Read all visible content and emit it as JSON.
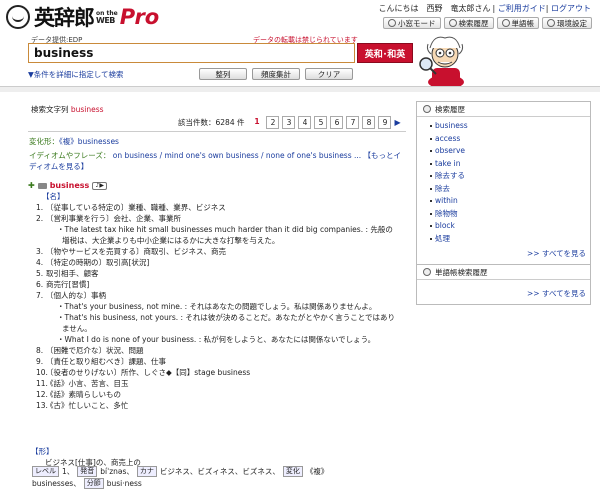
{
  "header": {
    "logo_text": "英辞郎",
    "logo_sub_top": "on the",
    "logo_sub_bottom": "WEB",
    "logo_pro": "Pro",
    "greeting": "こんにちは　西野　竜太郎さん",
    "nav": [
      {
        "label": "ご利用ガイド"
      },
      {
        "label": "ログアウト"
      }
    ],
    "toolbar": [
      {
        "label": "小窓モード",
        "icon": "window-icon"
      },
      {
        "label": "検索履歴",
        "icon": "history-icon"
      },
      {
        "label": "単語帳",
        "icon": "wordbook-icon"
      },
      {
        "label": "環境設定",
        "icon": "gear-icon"
      }
    ]
  },
  "search": {
    "provider": "データ提供:EDP",
    "notice": "データの転載は禁じられています",
    "query": "business",
    "dict_select": "英和･和英",
    "detail_link": "▼条件を詳細に指定して検索",
    "buttons": [
      "整列",
      "頻度集計",
      "クリア"
    ]
  },
  "results": {
    "query_label": "検索文字列",
    "query_value": "business",
    "count_label": "該当件数：6284 件",
    "pages": [
      "1",
      "2",
      "3",
      "4",
      "5",
      "6",
      "7",
      "8",
      "9"
    ],
    "current_page": "1",
    "inflect_label": "変化形：",
    "inflect_value": "《複》businesses",
    "idiom_label": "イディオムやフレーズ：",
    "idioms": "on business / mind one's own business / none of one's business ...",
    "idiom_more": "【もっとイディオムを見る】"
  },
  "entry": {
    "headword": "business",
    "audio_label": "♪▶",
    "pos_noun": "【名】",
    "lines": [
      {
        "type": "sense",
        "num": "1.",
        "text": "〔従事している特定の〕業種、職種、業界、ビジネス"
      },
      {
        "type": "sense",
        "num": "2.",
        "text": "〔営利事業を行う〕会社、企業、事業所"
      },
      {
        "type": "ex",
        "text": "・The latest tax hike hit small businesses much harder than it did big companies. : 先般の"
      },
      {
        "type": "excont",
        "text": "増税は、大企業よりも中小企業にはるかに大きな打撃を与えた。"
      },
      {
        "type": "sense",
        "num": "3.",
        "text": "〔物やサービスを売買する〕商取引、ビジネス、商売"
      },
      {
        "type": "sense",
        "num": "4.",
        "text": "〔特定の時期の〕取引高[状況]"
      },
      {
        "type": "sense",
        "num": "5.",
        "text": "取引相手、顧客"
      },
      {
        "type": "sense",
        "num": "6.",
        "text": "商売行[習慣]"
      },
      {
        "type": "sense",
        "num": "7.",
        "text": "〔個人的な〕事柄"
      },
      {
        "type": "ex",
        "text": "・That's your business, not mine. : それはあなたの問題でしょう。私は関係ありませんよ。"
      },
      {
        "type": "ex",
        "text": "・That's his business, not yours. : それは彼が決めることだ。あなたがとやかく言うことではあり"
      },
      {
        "type": "excont",
        "text": "ません。"
      },
      {
        "type": "ex",
        "text": "・What I do is none of your business. : 私が何をしようと、あなたには関係ないでしょう。"
      },
      {
        "type": "sense",
        "num": "8.",
        "text": "〔困難で厄介な〕状況、問題"
      },
      {
        "type": "sense",
        "num": "9.",
        "text": "〔責任と取り組むべき〕課題、仕事"
      },
      {
        "type": "sense",
        "num": "10.",
        "text": "〔役者のせりげない〕所作、しぐさ◆【同】stage business"
      },
      {
        "type": "sense",
        "num": "11.",
        "text": "《話》小言、苦言、目玉"
      },
      {
        "type": "sense",
        "num": "12.",
        "text": "《話》素晴らしいもの"
      },
      {
        "type": "sense",
        "num": "13.",
        "text": "《古》忙しいこと、多忙"
      }
    ],
    "pos_adj": "【形】",
    "adj_text": "ビジネス[仕事]の、商売上の",
    "level_label": "レベル",
    "level_value": "1、",
    "pron_label": "発音",
    "pron_value": "bíˈznəs、",
    "kana_label": "カナ",
    "kana_value": "ビジネス、ビズィネス、ビズネス、",
    "change_label": "変化",
    "change_prefix": "《複》",
    "change_value": "businesses、",
    "syll_label": "分節",
    "syll_value": "busi·ness"
  },
  "sidebar": {
    "history_title": "検索履歴",
    "history": [
      "business",
      "access",
      "observe",
      "take in",
      "除去する",
      "除去",
      "within",
      "除物物",
      "block",
      "処理"
    ],
    "history_more": ">> すべてを見る",
    "wordbook_title": "単語帳検索履歴",
    "wordbook_more": ">> すべてを見る"
  },
  "colors": {
    "accent_red": "#c8102e",
    "link_blue": "#1a3c9e",
    "green": "#3a7a1d"
  }
}
